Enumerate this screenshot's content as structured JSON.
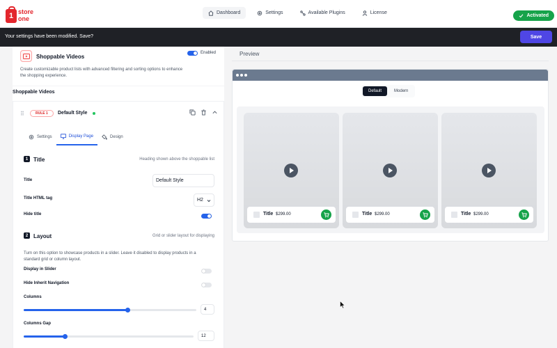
{
  "brand": {
    "line1": "store",
    "line2": "one",
    "color": "#e3262d"
  },
  "nav": {
    "items": [
      {
        "label": "Dashboard",
        "icon": "home-icon",
        "active": true
      },
      {
        "label": "Settings",
        "icon": "gear-icon"
      },
      {
        "label": "Available Plugins",
        "icon": "plugins-icon"
      },
      {
        "label": "License",
        "icon": "user-icon"
      }
    ],
    "status": "Activated"
  },
  "notice": {
    "message": "Your settings have been modified. Save?",
    "save_label": "Save"
  },
  "module": {
    "title": "Shoppable Videos",
    "enabled_label": "Enabled",
    "enabled": true,
    "description": "Create customizable product lists with advanced filtering and sorting options to enhance the shopping experience."
  },
  "section_label": "Shoppable Videos",
  "rule": {
    "badge": "RULE 1",
    "name": "Default Style",
    "tabs": [
      {
        "label": "Settings",
        "icon": "gear-icon"
      },
      {
        "label": "Display Page",
        "icon": "monitor-icon",
        "active": true
      },
      {
        "label": "Design",
        "icon": "paint-icon"
      }
    ],
    "title_section": {
      "step": "1",
      "heading": "Title",
      "hint": "Heading shown above the shoppable list",
      "title_label": "Title",
      "title_value": "Default Style",
      "tag_label": "Title HTML tag",
      "tag_value": "H2",
      "hide_label": "Hide title",
      "hide_on": true
    },
    "layout_section": {
      "step": "2",
      "heading": "Layout",
      "hint": "Grid or slider layout for displaying",
      "description": "Turn on this option to showcase products in a slider. Leave it disabled to display products in a standard grid or column layout.",
      "slider_label": "Display in Slider",
      "slider_on": false,
      "inherit_label": "Hide Inherit Navigation",
      "inherit_on": false,
      "columns_label": "Columns",
      "columns_value": "4",
      "columns_fraction": 0.6,
      "gap_label": "Columns Gap",
      "gap_value": "12",
      "gap_fraction": 0.24
    }
  },
  "preview": {
    "label": "Preview",
    "modes": [
      "Default",
      "Modern"
    ],
    "active_mode": "Default",
    "cards": [
      {
        "title": "Title",
        "price": "$299.00"
      },
      {
        "title": "Title",
        "price": "$299.00"
      },
      {
        "title": "Title",
        "price": "$299.00"
      }
    ]
  },
  "colors": {
    "accent": "#2563eb",
    "success": "#16a34a",
    "dark_bar": "#1f2126",
    "save": "#4f46e5"
  }
}
